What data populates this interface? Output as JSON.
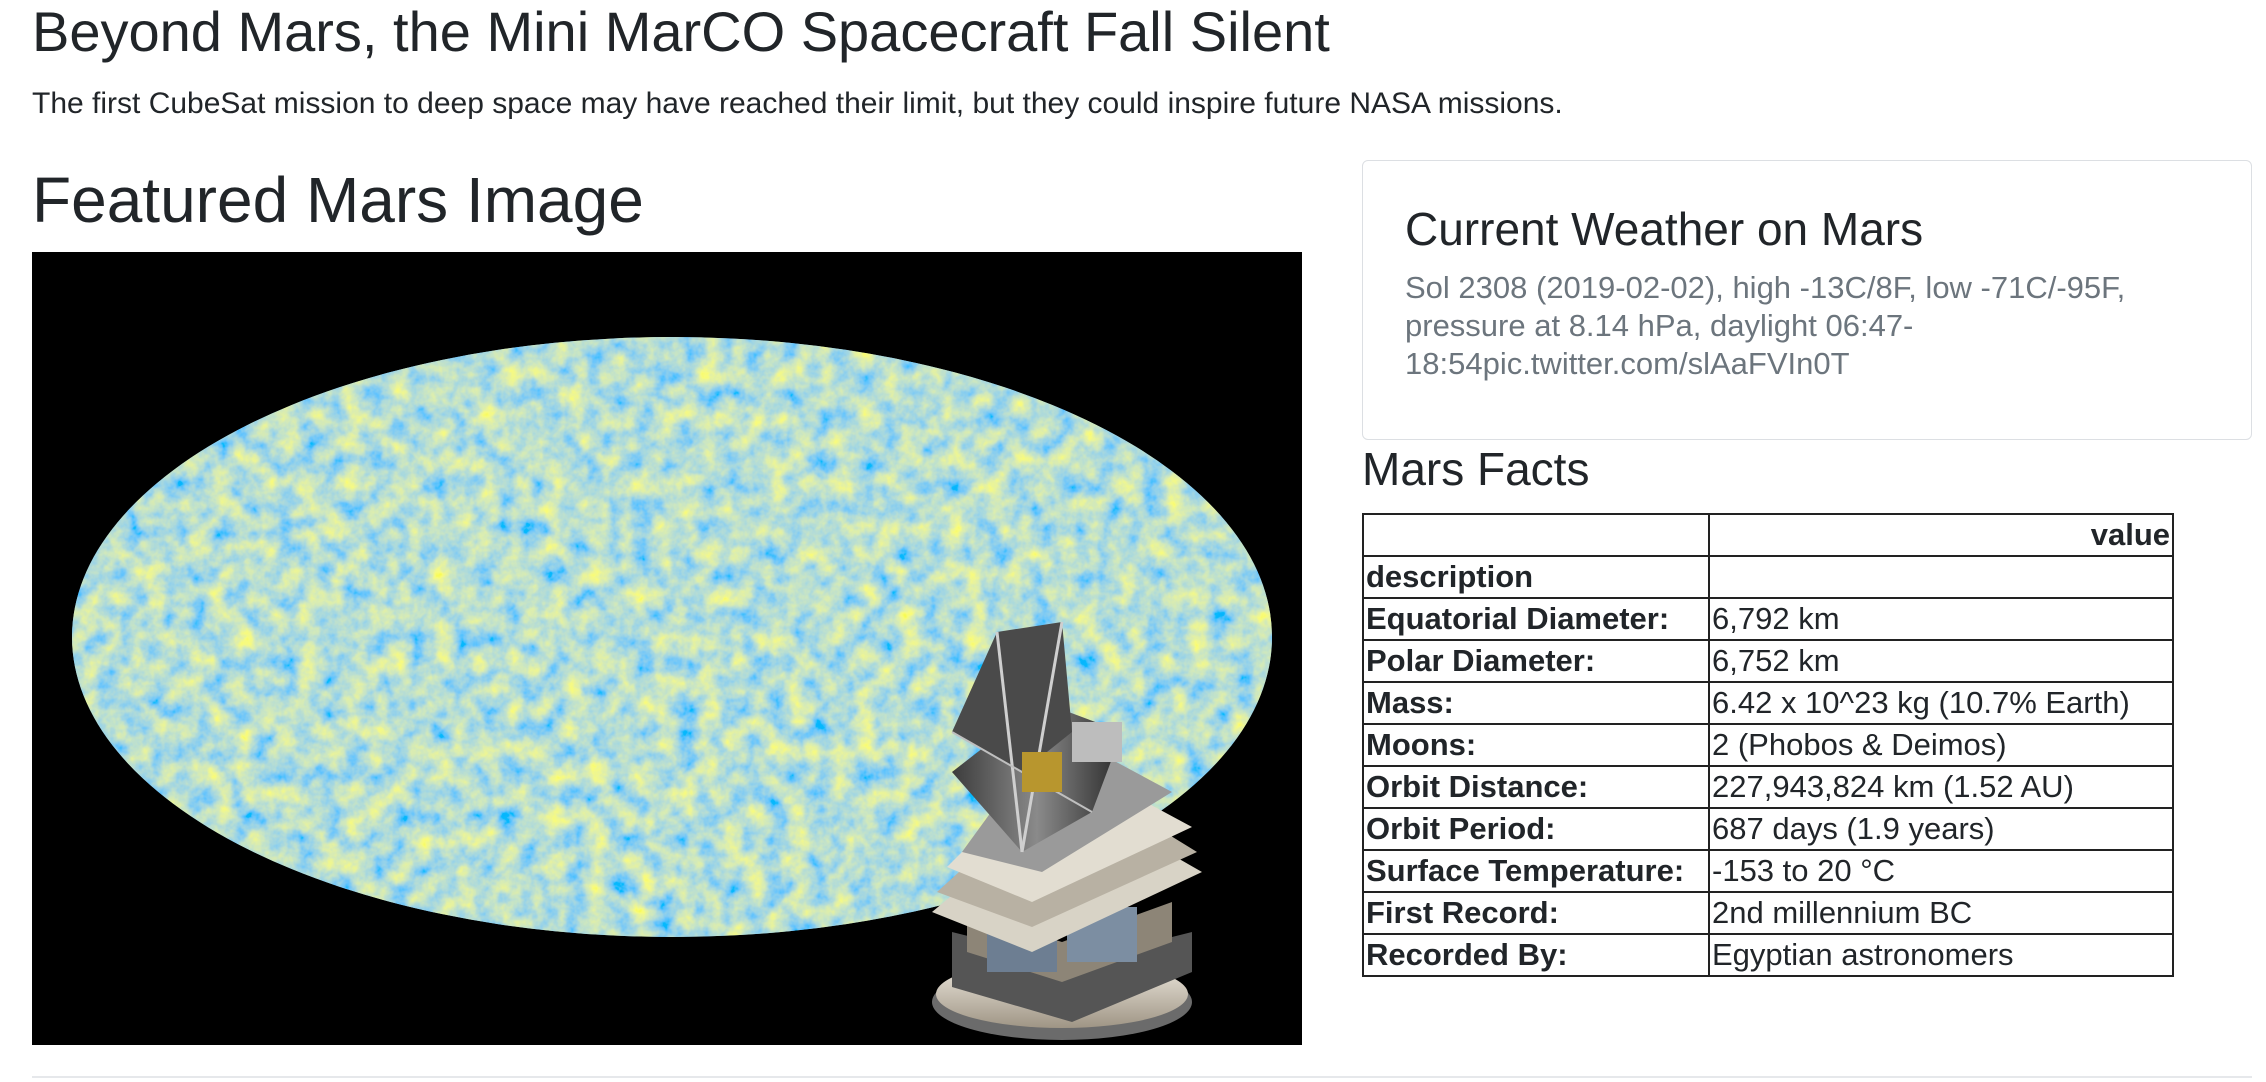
{
  "news": {
    "headline": "Beyond Mars, the Mini MarCO Spacecraft Fall Silent",
    "teaser": "The first CubeSat mission to deep space may have reached their limit, but they could inspire future NASA missions."
  },
  "featured": {
    "title": "Featured Mars Image"
  },
  "weather": {
    "title": "Current Weather on Mars",
    "text": "Sol 2308 (2019-02-02), high -13C/8F, low -71C/-95F, pressure at 8.14 hPa, daylight 06:47-18:54pic.twitter.com/slAaFVIn0T"
  },
  "facts": {
    "title": "Mars Facts",
    "header_value": "value",
    "header_index": "description",
    "rows": [
      {
        "label": "Equatorial Diameter:",
        "value": "6,792 km"
      },
      {
        "label": "Polar Diameter:",
        "value": "6,752 km"
      },
      {
        "label": "Mass:",
        "value": "6.42 x 10^23 kg (10.7% Earth)"
      },
      {
        "label": "Moons:",
        "value": "2 (Phobos & Deimos)"
      },
      {
        "label": "Orbit Distance:",
        "value": "227,943,824 km (1.52 AU)"
      },
      {
        "label": "Orbit Period:",
        "value": "687 days (1.9 years)"
      },
      {
        "label": "Surface Temperature:",
        "value": "-153 to 20 °C"
      },
      {
        "label": "First Record:",
        "value": "2nd millennium BC"
      },
      {
        "label": "Recorded By:",
        "value": "Egyptian astronomers"
      }
    ]
  }
}
